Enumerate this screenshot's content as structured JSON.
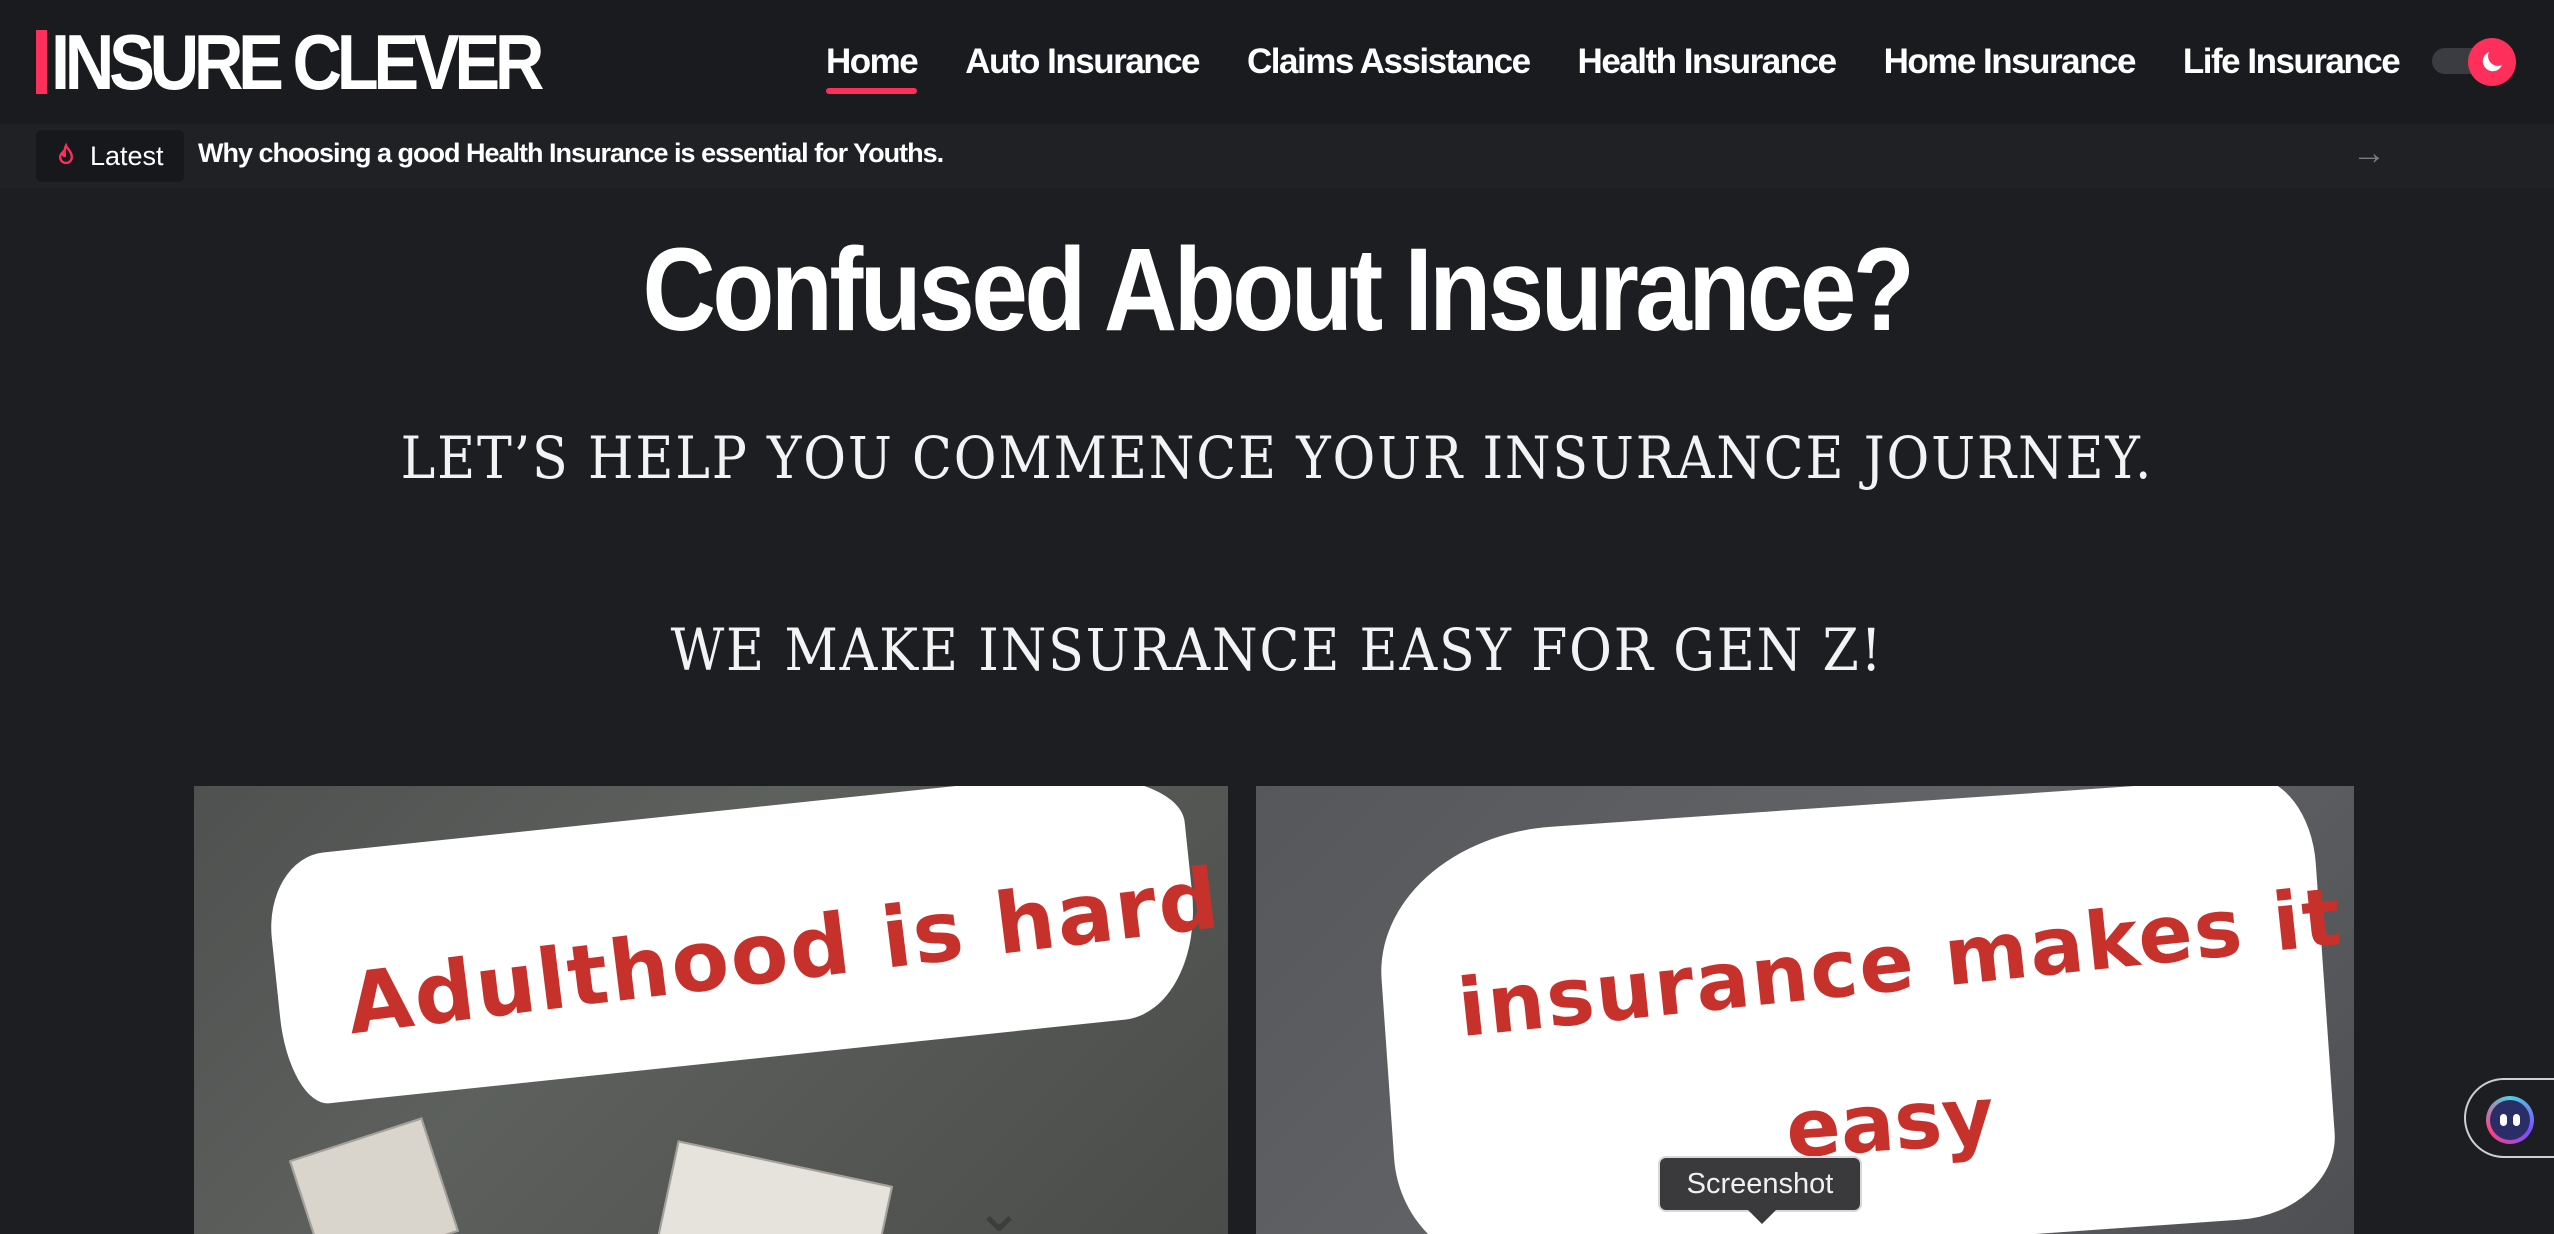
{
  "header": {
    "logo_text": "INSURE CLEVER",
    "nav": [
      {
        "label": "Home",
        "active": true
      },
      {
        "label": "Auto Insurance"
      },
      {
        "label": "Claims Assistance"
      },
      {
        "label": "Health Insurance"
      },
      {
        "label": "Home Insurance"
      },
      {
        "label": "Life Insurance"
      }
    ],
    "theme_toggle_icon": "moon-icon"
  },
  "ticker": {
    "badge_label": "Latest",
    "badge_icon": "flame-icon",
    "headline": "Why choosing a good Health Insurance is essential for Youths.",
    "arrow_icon": "arrow-right-icon"
  },
  "hero": {
    "title": "Confused About Insurance?",
    "subtitle_1": "LET’S HELP YOU COMMENCE YOUR INSURANCE JOURNEY.",
    "subtitle_2": "WE MAKE INSURANCE EASY FOR GEN Z!"
  },
  "images": {
    "left_text": "Adulthood is hard...",
    "right_text_1": "insurance makes it",
    "right_text_2": "easy"
  },
  "tooltip": {
    "label": "Screenshot"
  },
  "colors": {
    "accent": "#ff2f5b",
    "background": "#1c1e22",
    "brush_text": "#c7312c"
  }
}
